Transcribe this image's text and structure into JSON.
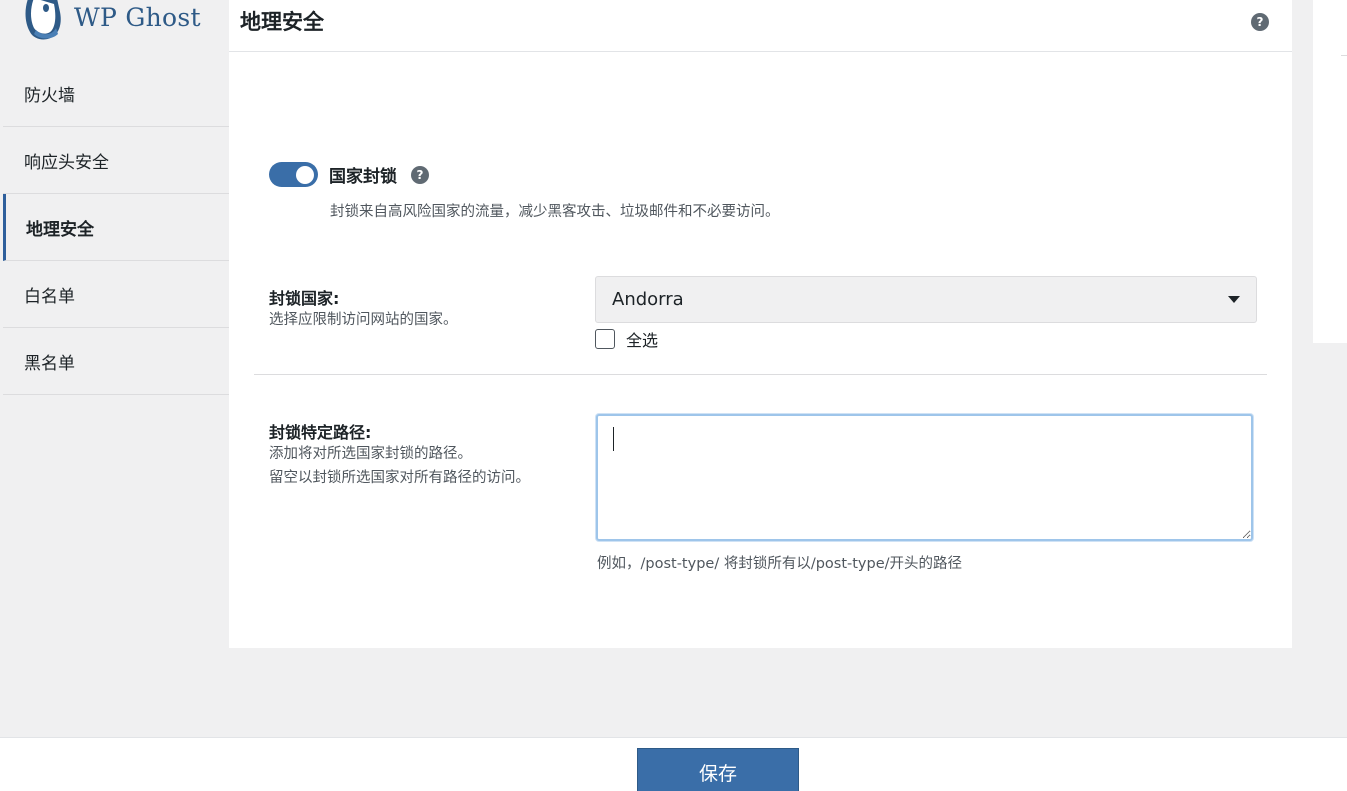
{
  "brand": {
    "name": "WP Ghost",
    "color": "#2e5a87"
  },
  "sidebar": {
    "items": [
      {
        "label": "防火墙",
        "active": false
      },
      {
        "label": "响应头安全",
        "active": false
      },
      {
        "label": "地理安全",
        "active": true
      },
      {
        "label": "白名单",
        "active": false
      },
      {
        "label": "黑名单",
        "active": false
      }
    ]
  },
  "header": {
    "title": "地理安全",
    "help_icon": "question-circle-icon"
  },
  "country_block": {
    "toggle_on": true,
    "label": "国家封锁",
    "description": "封锁来自高风险国家的流量，减少黑客攻击、垃圾邮件和不必要访问。"
  },
  "block_countries": {
    "label": "封锁国家:",
    "description": "选择应限制访问网站的国家。",
    "selected": "Andorra",
    "select_all_label": "全选",
    "select_all_checked": false
  },
  "block_paths": {
    "label": "封锁特定路径:",
    "description_1": "添加将对所选国家封锁的路径。",
    "description_2": "留空以封锁所选国家对所有路径的访问。",
    "value": "",
    "hint": "例如，/post-type/ 将封锁所有以/post-type/开头的路径"
  },
  "footer": {
    "save_label": "保存"
  },
  "colors": {
    "accent": "#3a6ea8",
    "focus_border": "#9ec5ea"
  }
}
